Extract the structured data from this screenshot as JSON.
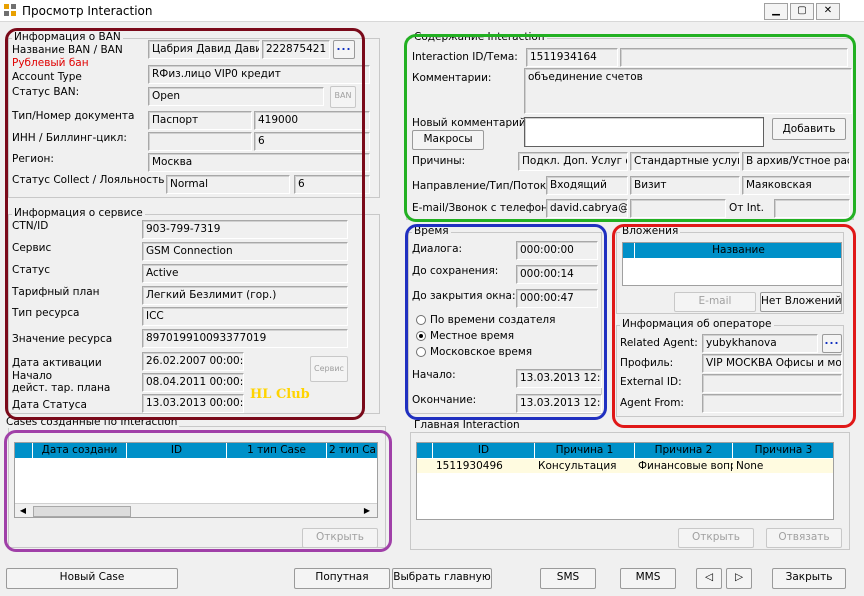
{
  "window": {
    "title": "Просмотр Interaction",
    "min": "▁",
    "max": "▢",
    "close": "✕"
  },
  "ban": {
    "group": "Информация о BAN",
    "name_label": "Название BAN / BAN",
    "name_value": "Цабрия Давид Дави",
    "ban_value": "222875421",
    "dots": "...",
    "ruble": "Рублевый бан",
    "acct_type_label": "Account Type",
    "acct_type_value": "RФиз.лицо  VIP0  кредит",
    "status_label": "Статус BAN:",
    "status_value": "Open",
    "status_btn": "BAN",
    "doc_label": "Тип/Номер документа",
    "doc_type": "Паспорт",
    "doc_num": "419000",
    "inn_label": "ИНН    / Биллинг-цикл:",
    "inn_value": "",
    "cycle_value": "6",
    "region_label": "Регион:",
    "region_value": "Москва",
    "collect_label": "Статус Collect / Лояльность",
    "collect_value": "Normal",
    "loyal_value": "6"
  },
  "service": {
    "group": "Информация о сервисе",
    "ctn_label": "CTN/ID",
    "ctn_value": "903-799-7319",
    "svc_label": "Сервис",
    "svc_value": "GSM Connection",
    "status_label": "Статус",
    "status_value": "Active",
    "plan_label": "Тарифный план",
    "plan_value": "Легкий Безлимит (гор.)",
    "res_type_label": "Тип ресурса",
    "res_type_value": "ICC",
    "res_val_label": "Значение ресурса",
    "res_val_value": "897019910093377019",
    "act_label": "Дата активации",
    "act_value": "26.02.2007 00:00:0",
    "plan_start_label_1": "Начало",
    "plan_start_label_2": "дейст. тар. плана",
    "plan_start_value": "08.04.2011 00:00:0",
    "status_date_label": "Дата Статуса",
    "status_date_value": "13.03.2013 00:00:0",
    "svc_btn": "Сервис",
    "hl": "HL Club"
  },
  "content": {
    "group": "Содержание Interaction",
    "id_label": "Interaction ID/Тема:",
    "id_value": "1511934164",
    "topic_value": "",
    "comment_label": "Комментарии:",
    "comment_value": "объединение счетов",
    "new_comment_label": "Новый комментарий:",
    "new_comment_value": "",
    "macros_btn": "Макросы",
    "add_btn": "Добавить",
    "reasons_label": "Причины:",
    "reason1": "Подкл. Доп. Услуг ф",
    "reason2": "Стандартные услуги",
    "reason3": "В архив/Устное расп",
    "direction_label": "Направление/Тип/Поток:",
    "dir1": "Входящий",
    "dir2": "Визит",
    "dir3": "Маяковская",
    "email_label": "E-mail/Звонок с телефона:",
    "email_value": "david.cabrya@",
    "phone_value": "",
    "from_label": "От Int.",
    "from_value": ""
  },
  "time": {
    "group": "Время",
    "dialog_label": "Диалога:",
    "dialog_value": "000:00:00",
    "save_label": "До сохранения:",
    "save_value": "000:00:14",
    "close_label": "До закрытия окна:",
    "close_value": "000:00:47",
    "radio1": "По времени создателя",
    "radio2": "Местное время",
    "radio3": "Московское время",
    "start_label": "Начало:",
    "start_value": "13.03.2013 12:0",
    "end_label": "Окончание:",
    "end_value": "13.03.2013 12:0"
  },
  "attach": {
    "group": "Вложения",
    "col_name": "Название",
    "email_btn": "E-mail",
    "none_btn": "Нет Вложений"
  },
  "operator": {
    "group": "Информация об операторе",
    "agent_label": "Related Agent:",
    "agent_value": "yubykhanova",
    "dots": "...",
    "profile_label": "Профиль:",
    "profile_value": "VIP МОСКВА Офисы и моду",
    "ext_label": "External ID:",
    "ext_value": "",
    "from_label": "Agent From:",
    "from_value": ""
  },
  "cases": {
    "group": "Cases созданные по Interaction",
    "columns": [
      "Дата создани",
      "ID",
      "1 тип Case",
      "2 тип Ca"
    ],
    "open_btn": "Открыть"
  },
  "main_int": {
    "group": "Главная Interaction",
    "columns": [
      "ID",
      "Причина 1",
      "Причина 2",
      "Причина 3"
    ],
    "row": [
      "1511930496",
      "Консультация",
      "Финансовые вопр",
      "None"
    ],
    "open_btn": "Открыть",
    "unlink_btn": "Отвязать"
  },
  "bottom": {
    "new_case": "Новый Case",
    "incidental": "Попутная",
    "choose_main": "Выбрать главную",
    "sms": "SMS",
    "mms": "MMS",
    "prev": "◁",
    "next": "▷",
    "close": "Закрыть"
  },
  "colors": {
    "ban_box": "#7a0a1a",
    "content_box": "#22b022",
    "time_box": "#2030c0",
    "attach_box": "#e01818",
    "cases_box": "#a040a8",
    "grid_header": "#0090c8"
  }
}
